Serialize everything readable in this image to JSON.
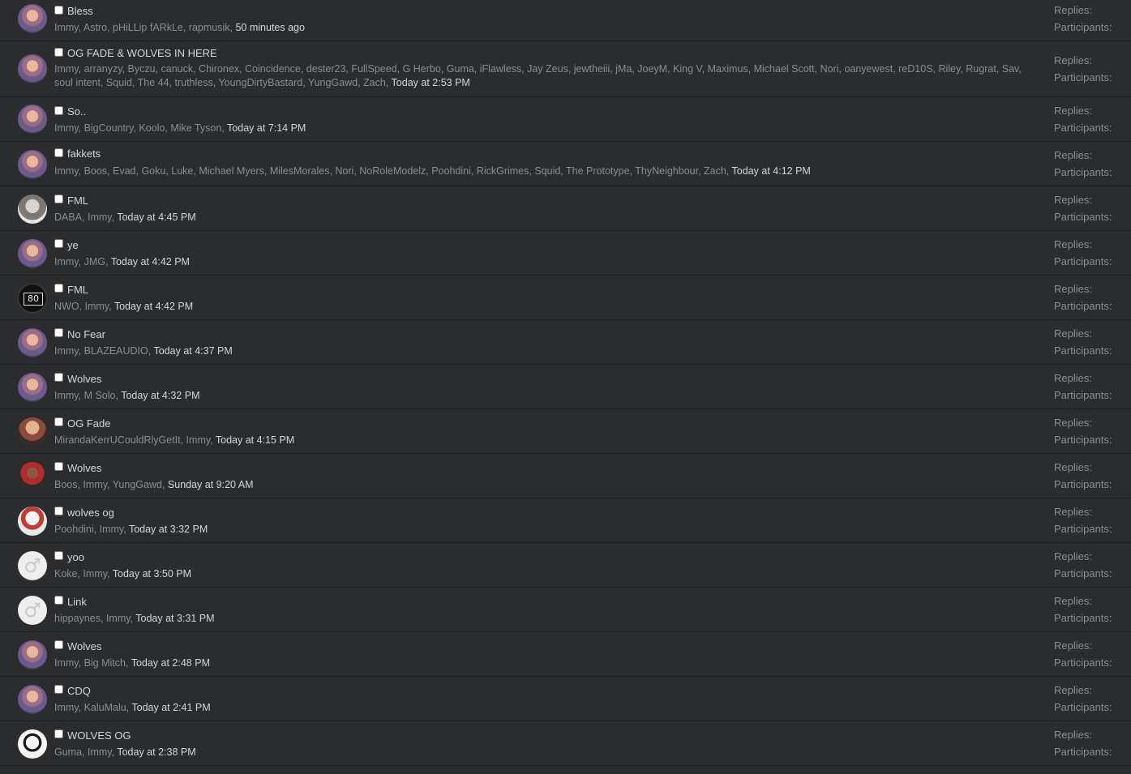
{
  "stats_labels": {
    "replies": "Replies:",
    "participants": "Participants:"
  },
  "conversations": [
    {
      "title": "Bless",
      "participants": "Immy, Astro, pHiLLip fARkLe, rapmusik,",
      "time": "50 minutes ago",
      "avatar": "immy-avatar"
    },
    {
      "title": "OG FADE & WOLVES IN HERE",
      "participants": "Immy, arranyzy, Byczu, canuck, Chironex, Coincidence, dester23, FullSpeed, G Herbo, Guma, iFlawless, Jay Zeus, jewtheiii, jMa, JoeyM, King V, Maximus, Michael Scott, Nori, oanyewest, reD10S, Riley, Rugrat, Sav, soul intent, Squid, The 44, truthless, YoungDirtyBastard, YungGawd, Zach,",
      "time": "Today at 2:53 PM",
      "avatar": "immy-avatar"
    },
    {
      "title": "So..",
      "participants": "Immy, BigCountry, Koolo, Mike Tyson,",
      "time": "Today at 7:14 PM",
      "avatar": "immy-avatar"
    },
    {
      "title": "fakkets",
      "participants": "Immy, Boos, Evad, Goku, Luke, Michael Myers, MilesMorales, Nori, NoRoleModelz, Poohdini, RickGrimes, Squid, The Prototype, ThyNeighbour, Zach,",
      "time": "Today at 4:12 PM",
      "avatar": "immy-avatar"
    },
    {
      "title": "FML",
      "participants": "DABA, Immy,",
      "time": "Today at 4:45 PM",
      "avatar": "daba-avatar"
    },
    {
      "title": "ye",
      "participants": "Immy, JMG,",
      "time": "Today at 4:42 PM",
      "avatar": "immy-avatar"
    },
    {
      "title": "FML",
      "participants": "NWO, Immy,",
      "time": "Today at 4:42 PM",
      "avatar": "nwo-avatar",
      "avatar_text": "80"
    },
    {
      "title": "No Fear",
      "participants": "Immy, BLAZEAUDIO,",
      "time": "Today at 4:37 PM",
      "avatar": "immy-avatar"
    },
    {
      "title": "Wolves",
      "participants": "Immy, M Solo,",
      "time": "Today at 4:32 PM",
      "avatar": "immy-avatar"
    },
    {
      "title": "OG Fade",
      "participants": "MirandaKerrUCouldRlyGetIt, Immy,",
      "time": "Today at 4:15 PM",
      "avatar": "miranda-avatar"
    },
    {
      "title": "Wolves",
      "participants": "Boos, Immy, YungGawd,",
      "time": "Sunday at 9:20 AM",
      "avatar": "boos-avatar"
    },
    {
      "title": "wolves og",
      "participants": "Poohdini, Immy,",
      "time": "Today at 3:32 PM",
      "avatar": "poohdini-avatar"
    },
    {
      "title": "yoo",
      "participants": "Koke, Immy,",
      "time": "Today at 3:50 PM",
      "avatar": "default-male-avatar"
    },
    {
      "title": "Link",
      "participants": "hippaynes, Immy,",
      "time": "Today at 3:31 PM",
      "avatar": "default-male-avatar"
    },
    {
      "title": "Wolves",
      "participants": "Immy, Big Mitch,",
      "time": "Today at 2:48 PM",
      "avatar": "immy-avatar"
    },
    {
      "title": "CDQ",
      "participants": "Immy, KaluMalu,",
      "time": "Today at 2:41 PM",
      "avatar": "immy-avatar"
    },
    {
      "title": "WOLVES OG",
      "participants": "Guma, Immy,",
      "time": "Today at 2:38 PM",
      "avatar": "guma-avatar"
    }
  ]
}
